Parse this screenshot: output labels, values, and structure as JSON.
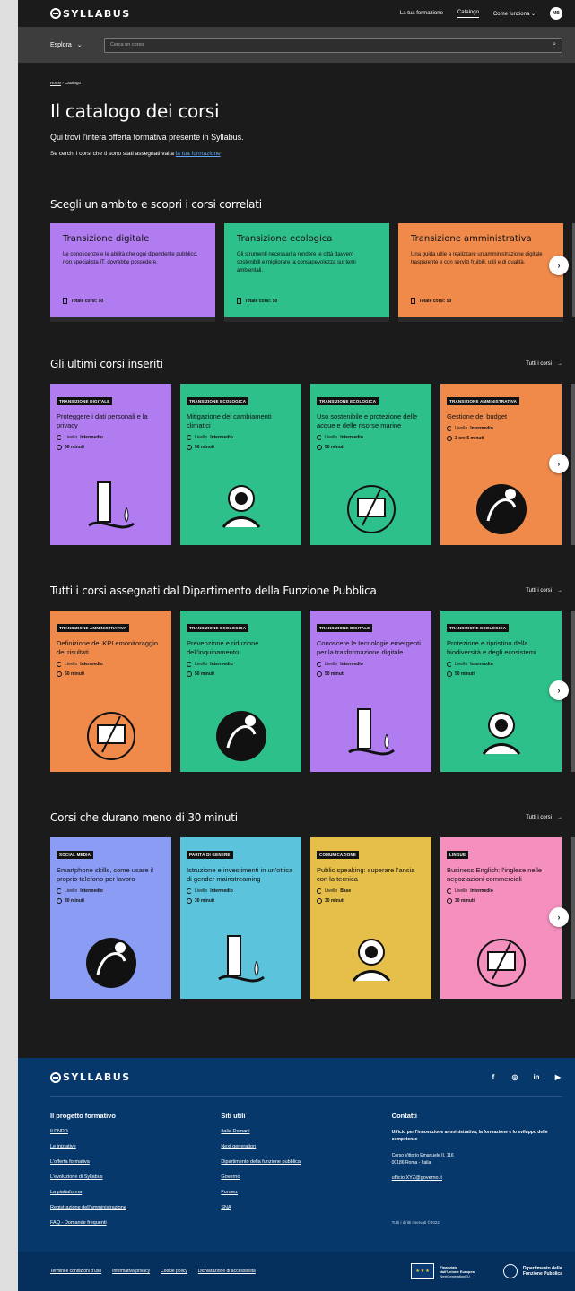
{
  "brand": "SYLLABUS",
  "nav": {
    "item1": "La tua formazione",
    "item2": "Catalogo",
    "item3": "Come funziona",
    "avatar": "MB"
  },
  "search": {
    "explore_label": "Esplora",
    "placeholder": "Cerca un corso"
  },
  "breadcrumb": {
    "home": "Home",
    "current": "Catalogo"
  },
  "page_title": "Il catalogo dei corsi",
  "intro": "Qui trovi l'intera offerta formativa presente in Syllabus.",
  "intro2_prefix": "Se cerchi i corsi che ti sono stati assegnati vai a",
  "intro2_link": "la tua formazione",
  "areas": {
    "title": "Scegli un ambito e scopri i corsi correlati",
    "items": [
      {
        "title": "Transizione digitale",
        "desc": "Le conoscenze e le abilità che ogni dipendente pubblico, non specialista IT, dovrebbe possedere.",
        "total": "Totale corsi: 50",
        "color": "#b07cf0"
      },
      {
        "title": "Transizione ecologica",
        "desc": "Gli strumenti necessari a rendere le città davvero sostenibili e migliorare la consapevolezza sui temi ambientali.",
        "total": "Totale corsi: 50",
        "color": "#2ec08a"
      },
      {
        "title": "Transizione amministrativa",
        "desc": "Una guida utile a realizzare un'amministrazione digitale trasparente e con servizi fruibili, utili e di qualità.",
        "total": "Totale corsi: 50",
        "color": "#f08a4b"
      }
    ]
  },
  "all_courses_label": "Tutti i corsi",
  "level_prefix": "Livello",
  "section_latest": {
    "title": "Gli ultimi corsi inseriti",
    "cards": [
      {
        "tag": "TRANSIZIONE DIGITALE",
        "title": "Proteggere i dati personali e la privacy",
        "level": "Intermedio",
        "duration": "50 minuti",
        "color": "#b07cf0"
      },
      {
        "tag": "TRANSIZIONE ECOLOGICA",
        "title": "Mitigazione dei cambiamenti climatici",
        "level": "Intermedio",
        "duration": "50 minuti",
        "color": "#2ec08a"
      },
      {
        "tag": "TRANSIZIONE ECOLOGICA",
        "title": "Uso sostenibile e protezione delle acque e delle risorse marine",
        "level": "Intermedio",
        "duration": "50 minuti",
        "color": "#2ec08a"
      },
      {
        "tag": "TRANSIZIONE AMMINISTRATIVA",
        "title": "Gestione del budget",
        "level": "Intermedio",
        "duration": "2 ore 5 minuti",
        "color": "#f08a4b"
      }
    ]
  },
  "section_assigned": {
    "title": "Tutti i corsi assegnati dal Dipartimento della Funzione Pubblica",
    "cards": [
      {
        "tag": "TRANSIZIONE AMMINISTRATIVA",
        "title": "Definizione dei KPI emonitoraggio dei risultati",
        "level": "Intermedio",
        "duration": "50 minuti",
        "color": "#f08a4b"
      },
      {
        "tag": "TRANSIZIONE ECOLOGICA",
        "title": "Prevenzione e riduzione dell'inquinamento",
        "level": "Intermedio",
        "duration": "50 minuti",
        "color": "#2ec08a"
      },
      {
        "tag": "TRANSIZIONE DIGITALE",
        "title": "Conoscere le tecnologie emergenti per la trasformazione digitale",
        "level": "Intermedio",
        "duration": "50 minuti",
        "color": "#b07cf0"
      },
      {
        "tag": "TRANSIZIONE ECOLOGICA",
        "title": "Protezione e ripristino della biodiversità e degli ecosistemi",
        "level": "Intermedio",
        "duration": "50 minuti",
        "color": "#2ec08a"
      }
    ]
  },
  "section_short": {
    "title": "Corsi che durano meno di 30 minuti",
    "cards": [
      {
        "tag": "SOCIAL MEDIA",
        "title": "Smartphone skills, come usare il proprio telefono per lavoro",
        "level": "Intermedio",
        "duration": "30 minuti",
        "color": "#8b9cf5"
      },
      {
        "tag": "PARITÀ DI GENERE",
        "title": "Istruzione e investimenti in un'ottica di gender mainstreaming",
        "level": "Intermedio",
        "duration": "30 minuti",
        "color": "#5bc3dc"
      },
      {
        "tag": "COMUNICAZIONE",
        "title": "Public speaking: superare l'ansia con la tecnica",
        "level": "Base",
        "duration": "30 minuti",
        "color": "#e6bf4a"
      },
      {
        "tag": "LINGUE",
        "title": "Business English: l'inglese nelle negoziazioni commerciali",
        "level": "Intermedio",
        "duration": "30 minuti",
        "color": "#f58fbe"
      }
    ]
  },
  "footer": {
    "brand": "SYLLABUS",
    "social": [
      "f",
      "◎",
      "in",
      "▶"
    ],
    "col1_title": "Il progetto formativo",
    "col1_links": [
      "Il PNRR",
      "Le iniziative",
      "L'offerta formativa",
      "L'evoluzione di Syllabus",
      "La piattaforma",
      "Registrazione dell'amministrazione",
      "FAQ - Domande frequenti"
    ],
    "col2_title": "Siti utili",
    "col2_links": [
      "Italia Domani",
      "Next generation",
      "Dipartimento della funzione pubblica",
      "Governo",
      "Formez",
      "SNA"
    ],
    "col3_title": "Contatti",
    "office": "Ufficio per l'innovazione amministrativa, la formazione e lo sviluppo delle competenze",
    "address1": "Corso Vittorio Emanuele II, 116",
    "address2": "00186 Roma - Italia",
    "email": "ufficio.XYZ@governo.it",
    "copyright": "Tutti i diritti riservati ©2022",
    "bottom_links": [
      "Termini e condizioni d'uso",
      "Informativa privacy",
      "Cookie policy",
      "Dichiarazione di accessibilità"
    ],
    "eu_text1": "Finanziato",
    "eu_text2": "dall'Unione Europea",
    "eu_text3": "NextGenerationEU",
    "dept1": "Dipartimento della",
    "dept2": "Funzione Pubblica"
  }
}
